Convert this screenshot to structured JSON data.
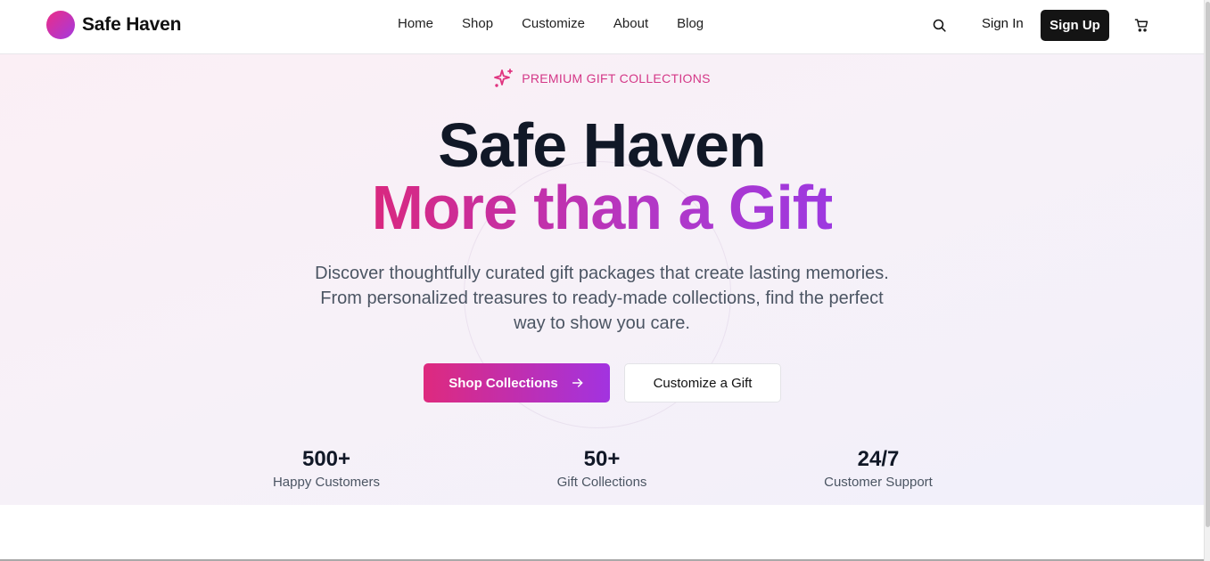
{
  "header": {
    "brand_name": "Safe Haven",
    "nav": [
      "Home",
      "Shop",
      "Customize",
      "About",
      "Blog"
    ],
    "sign_in": "Sign In",
    "sign_up": "Sign Up"
  },
  "hero": {
    "eyebrow": "PREMIUM GIFT COLLECTIONS",
    "title_line1": "Safe Haven",
    "title_line2": "More than a Gift",
    "subtitle": "Discover thoughtfully curated gift packages that create lasting memories. From personalized treasures to ready-made collections, find the perfect way to show you care.",
    "primary_cta": "Shop Collections",
    "secondary_cta": "Customize a Gift"
  },
  "stats": [
    {
      "value": "500+",
      "label": "Happy Customers"
    },
    {
      "value": "50+",
      "label": "Gift Collections"
    },
    {
      "value": "24/7",
      "label": "Customer Support"
    }
  ],
  "icons": {
    "search": "search-icon",
    "cart": "cart-icon",
    "sparkles": "sparkles-icon",
    "arrow": "arrow-right-icon"
  },
  "colors": {
    "accent_pink": "#de2a7e",
    "accent_purple": "#a233e0",
    "dark": "#141414"
  }
}
